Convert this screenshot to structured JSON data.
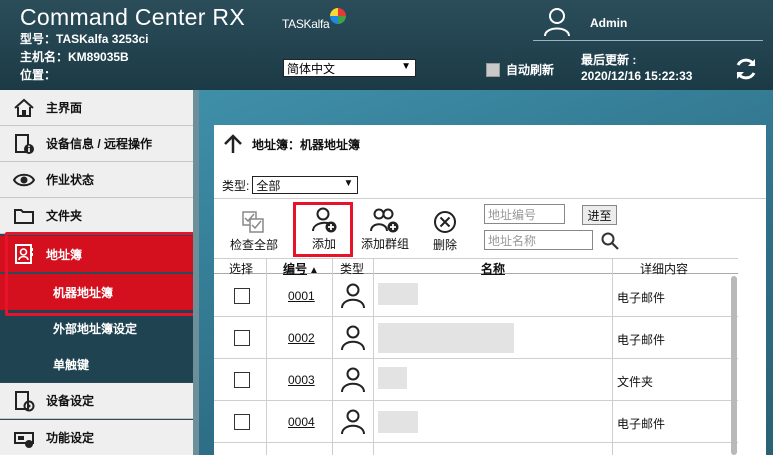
{
  "header": {
    "title": "Command Center RX",
    "model_label": "型号：",
    "model_value": "TASKalfa 3253ci",
    "host_label": "主机名：",
    "host_value": "KM89035B",
    "location_label": "位置："
  },
  "brand": "TASKalfa",
  "language": {
    "selected": "简体中文"
  },
  "user": {
    "name": "Admin"
  },
  "auto_refresh": {
    "label": "自动刷新",
    "checked": false
  },
  "last_update": {
    "label": "最后更新 :",
    "value": "2020/12/16 15:22:33"
  },
  "sidebar": {
    "items": [
      {
        "label": "主界面",
        "icon": "home-icon"
      },
      {
        "label": "设备信息 / 远程操作",
        "icon": "device-info-icon"
      },
      {
        "label": "作业状态",
        "icon": "eye-icon"
      },
      {
        "label": "文件夹",
        "icon": "folder-icon"
      },
      {
        "label": "地址簿",
        "icon": "address-book-icon"
      },
      {
        "label": "设备设定",
        "icon": "device-settings-icon"
      },
      {
        "label": "功能设定",
        "icon": "function-settings-icon"
      }
    ],
    "subitems": [
      {
        "label": "机器地址簿"
      },
      {
        "label": "外部地址簿设定"
      },
      {
        "label": "单触键"
      }
    ]
  },
  "panel": {
    "title": "地址簿：机器地址簿",
    "type_label": "类型:",
    "type_selected": "全部"
  },
  "toolbar": {
    "check_all": "检查全部",
    "add": "添加",
    "add_group": "添加群组",
    "delete": "删除",
    "address_number_placeholder": "地址编号",
    "address_name_placeholder": "地址名称",
    "go": "进至"
  },
  "table": {
    "headers": {
      "select": "选择",
      "number": "编号",
      "type": "类型",
      "name": "名称",
      "detail": "详细内容"
    },
    "sort_indicator": "▲",
    "rows": [
      {
        "number": "0001",
        "detail": "电子邮件"
      },
      {
        "number": "0002",
        "detail": "电子邮件"
      },
      {
        "number": "0003",
        "detail": "文件夹"
      },
      {
        "number": "0004",
        "detail": "电子邮件"
      }
    ]
  }
}
